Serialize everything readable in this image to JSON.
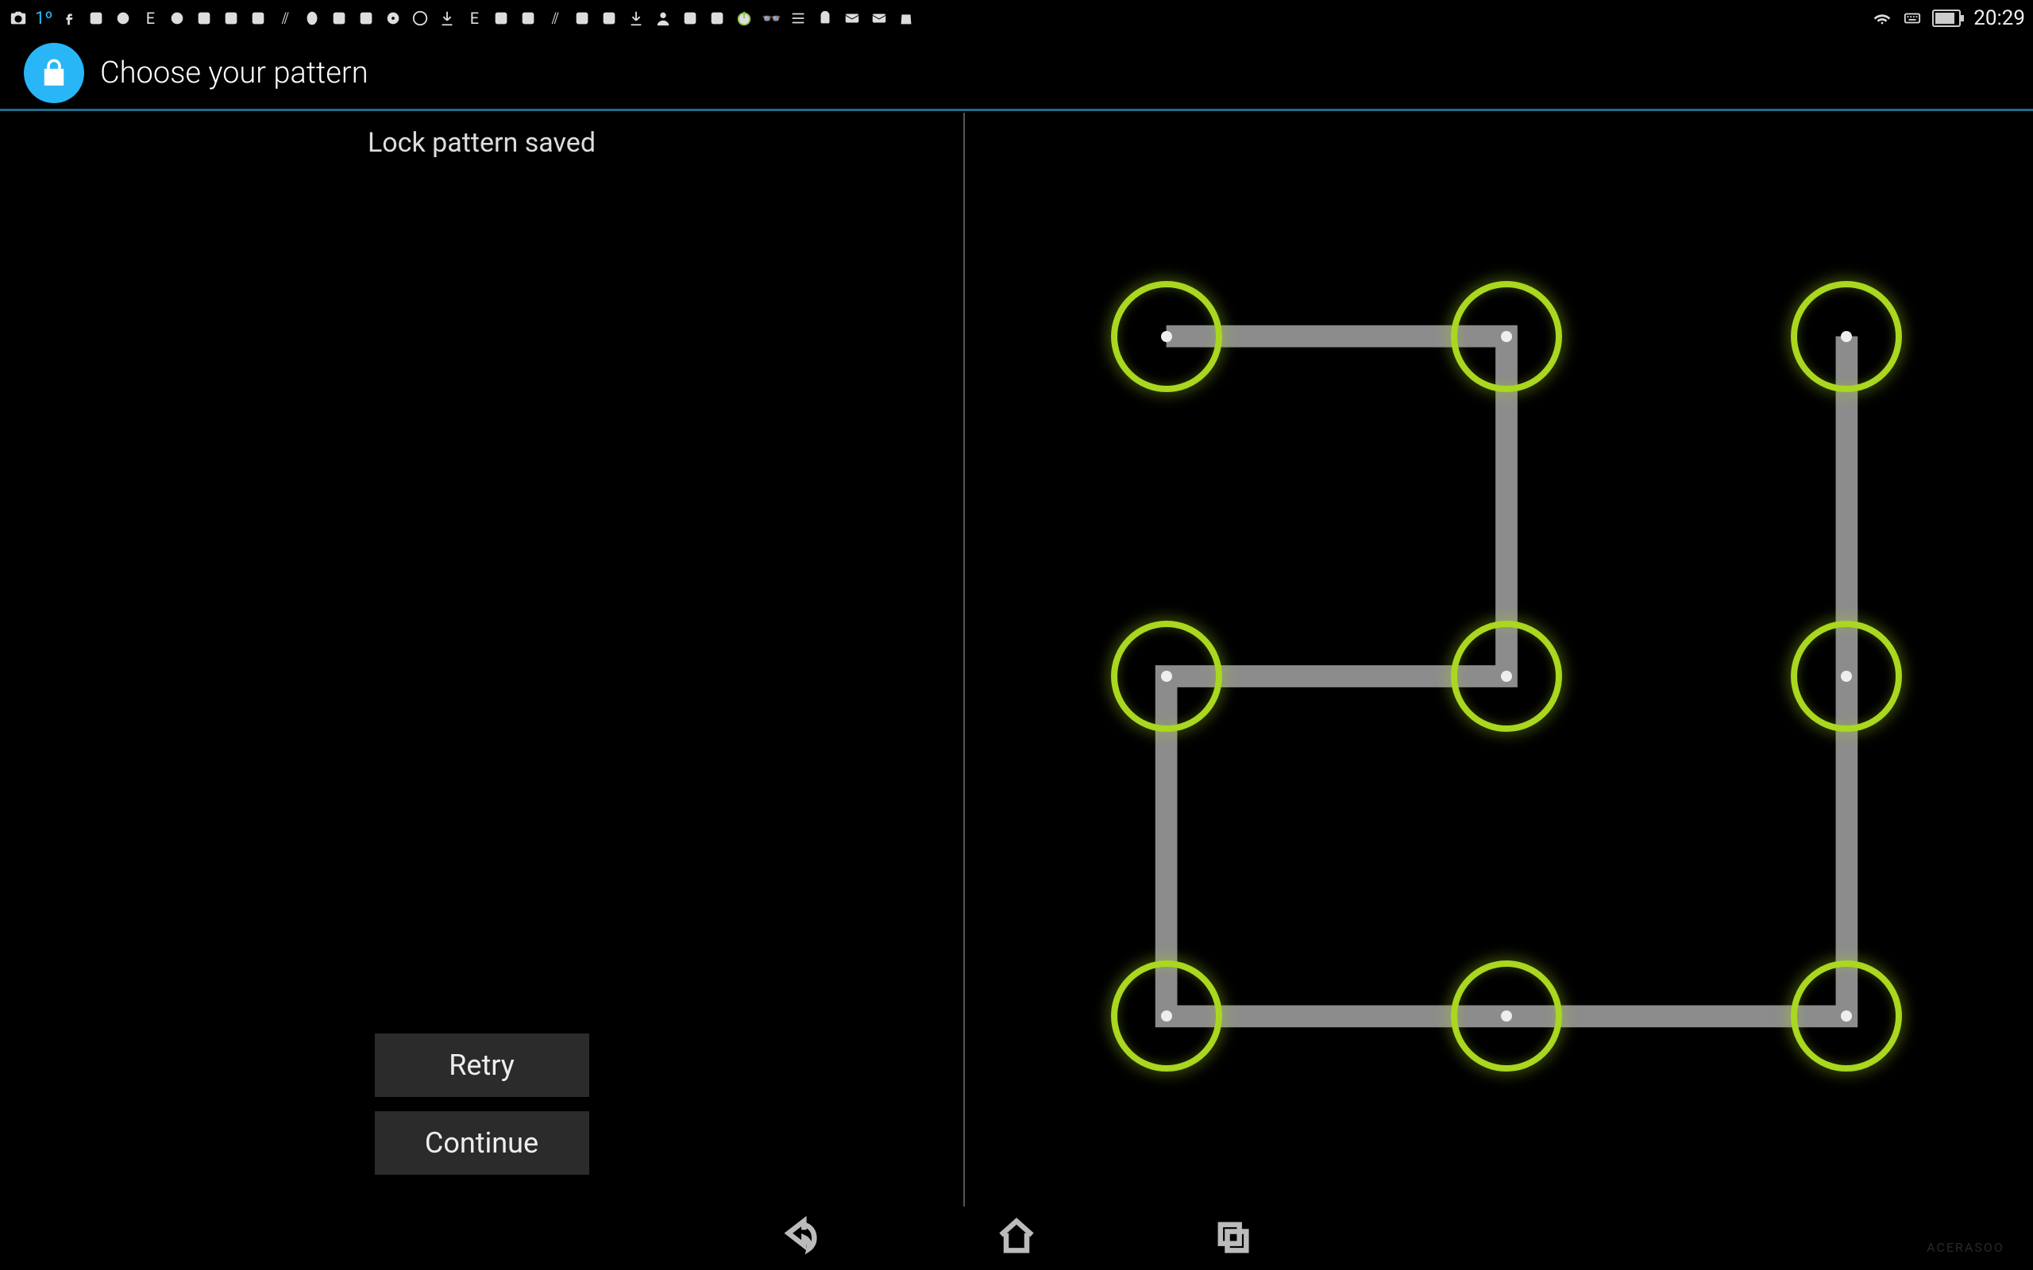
{
  "statusbar": {
    "temperature": "1º",
    "time": "20:29",
    "left_icons": [
      "camera",
      "temp",
      "facebook",
      "app",
      "game",
      "badge-e",
      "game2",
      "game3",
      "game4",
      "game5",
      "slash",
      "mask",
      "app2",
      "game6",
      "circle-dot",
      "spinner",
      "download",
      "badge-e2",
      "game7",
      "game8",
      "slash2",
      "game9",
      "game10",
      "download2",
      "user",
      "game11",
      "game12",
      "power",
      "glasses",
      "lines",
      "android",
      "mail",
      "mail2",
      "bag"
    ],
    "right_icons": [
      "wifi",
      "keyboard",
      "battery",
      "clock"
    ]
  },
  "titlebar": {
    "title": "Choose your pattern"
  },
  "left": {
    "status_message": "Lock pattern saved",
    "retry_label": "Retry",
    "continue_label": "Continue"
  },
  "pattern": {
    "grid": 3,
    "dot_positions_pct": [
      16,
      50,
      84
    ],
    "sequence": [
      0,
      1,
      4,
      3,
      6,
      7,
      8,
      2
    ],
    "highlight_color": "#aad71f"
  },
  "nav": {
    "back": "back",
    "home": "home",
    "recent": "recent"
  },
  "watermark": "ACERASOO"
}
